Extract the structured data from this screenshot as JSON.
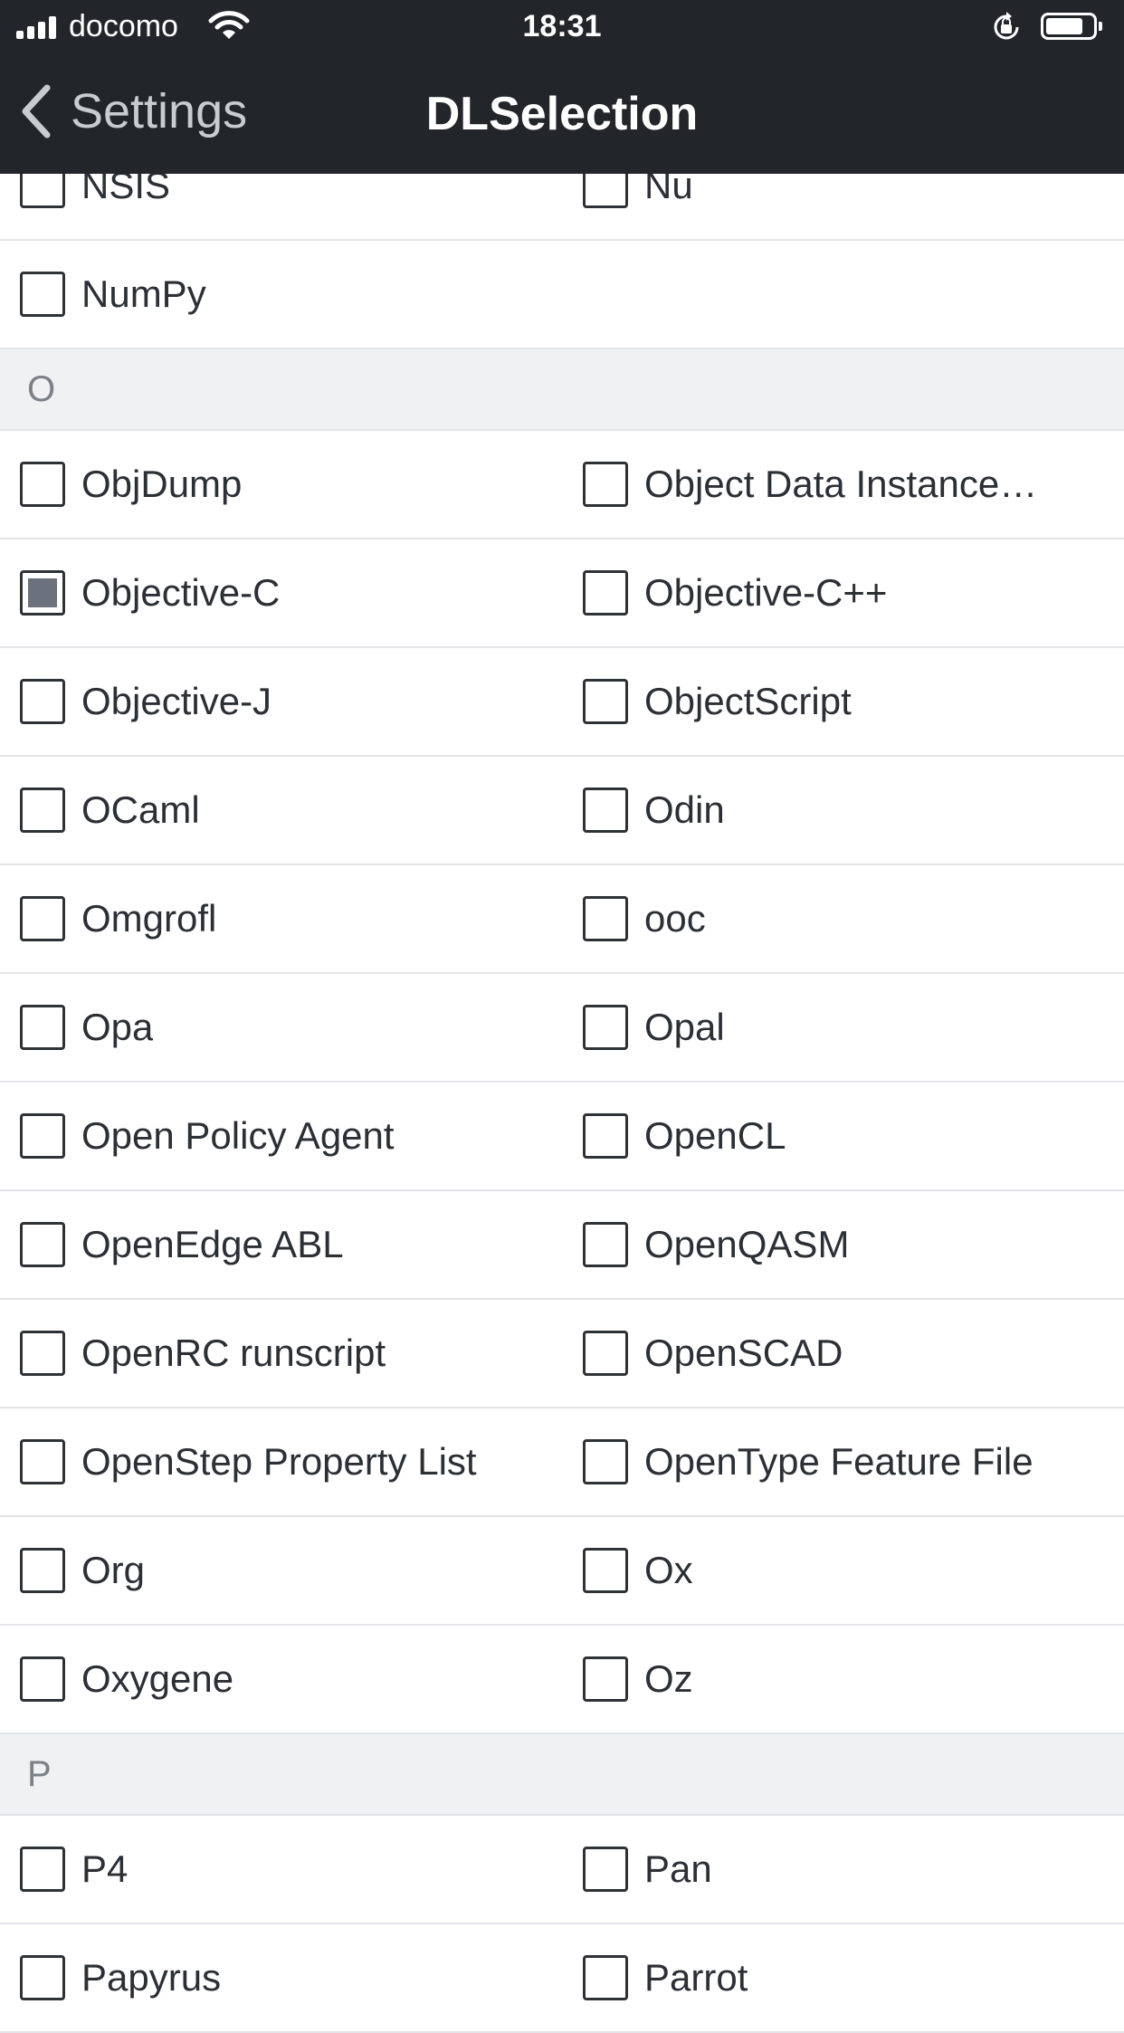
{
  "status_bar": {
    "carrier": "docomo",
    "time": "18:31",
    "icons": [
      "signal-icon",
      "wifi-icon",
      "orientation-lock-icon",
      "battery-icon"
    ]
  },
  "nav": {
    "back_label": "Settings",
    "title": "DLSelection"
  },
  "rows": [
    {
      "type": "item",
      "left": {
        "label": "NSIS",
        "checked": false
      },
      "right": {
        "label": "Nu",
        "checked": false
      }
    },
    {
      "type": "item",
      "left": {
        "label": "NumPy",
        "checked": false
      }
    },
    {
      "type": "section",
      "label": "O"
    },
    {
      "type": "item",
      "left": {
        "label": "ObjDump",
        "checked": false
      },
      "right": {
        "label": "Object Data Instance…",
        "checked": false
      }
    },
    {
      "type": "item",
      "left": {
        "label": "Objective-C",
        "checked": true
      },
      "right": {
        "label": "Objective-C++",
        "checked": false
      }
    },
    {
      "type": "item",
      "left": {
        "label": "Objective-J",
        "checked": false
      },
      "right": {
        "label": "ObjectScript",
        "checked": false
      }
    },
    {
      "type": "item",
      "left": {
        "label": "OCaml",
        "checked": false
      },
      "right": {
        "label": "Odin",
        "checked": false
      }
    },
    {
      "type": "item",
      "left": {
        "label": "Omgrofl",
        "checked": false
      },
      "right": {
        "label": "ooc",
        "checked": false
      }
    },
    {
      "type": "item",
      "left": {
        "label": "Opa",
        "checked": false
      },
      "right": {
        "label": "Opal",
        "checked": false
      }
    },
    {
      "type": "item",
      "left": {
        "label": "Open Policy Agent",
        "checked": false
      },
      "right": {
        "label": "OpenCL",
        "checked": false
      }
    },
    {
      "type": "item",
      "left": {
        "label": "OpenEdge ABL",
        "checked": false
      },
      "right": {
        "label": "OpenQASM",
        "checked": false
      }
    },
    {
      "type": "item",
      "left": {
        "label": "OpenRC runscript",
        "checked": false
      },
      "right": {
        "label": "OpenSCAD",
        "checked": false
      }
    },
    {
      "type": "item",
      "left": {
        "label": "OpenStep Property List",
        "checked": false
      },
      "right": {
        "label": "OpenType Feature File",
        "checked": false
      }
    },
    {
      "type": "item",
      "left": {
        "label": "Org",
        "checked": false
      },
      "right": {
        "label": "Ox",
        "checked": false
      }
    },
    {
      "type": "item",
      "left": {
        "label": "Oxygene",
        "checked": false
      },
      "right": {
        "label": "Oz",
        "checked": false
      }
    },
    {
      "type": "section",
      "label": "P"
    },
    {
      "type": "item",
      "left": {
        "label": "P4",
        "checked": false
      },
      "right": {
        "label": "Pan",
        "checked": false
      }
    },
    {
      "type": "item",
      "left": {
        "label": "Papyrus",
        "checked": false
      },
      "right": {
        "label": "Parrot",
        "checked": false
      }
    }
  ]
}
